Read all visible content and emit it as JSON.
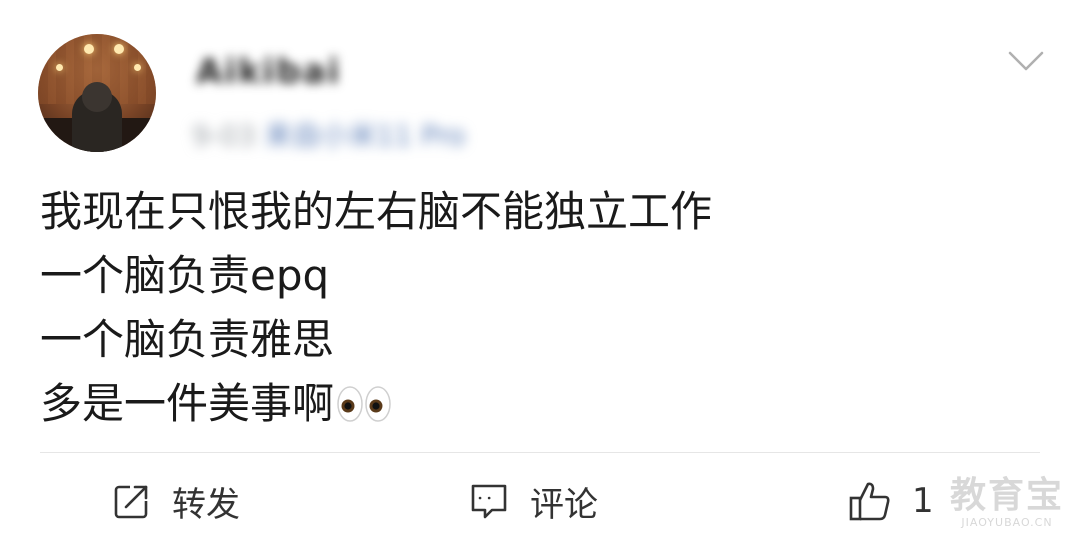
{
  "post": {
    "username": "Aikibai",
    "meta_time": "9-03",
    "meta_source": "来自小米11 Pro",
    "lines": [
      "我现在只恨我的左右脑不能独立工作",
      "一个脑负责epq",
      "一个脑负责雅思",
      "多是一件美事啊"
    ],
    "trailing_emoji_icon": "eyes-emoji-icon"
  },
  "actions": {
    "repost_label": "转发",
    "comment_label": "评论",
    "like_count": "1"
  },
  "watermark": {
    "title": "教育宝",
    "url": "JIAOYUBAO.CN"
  }
}
